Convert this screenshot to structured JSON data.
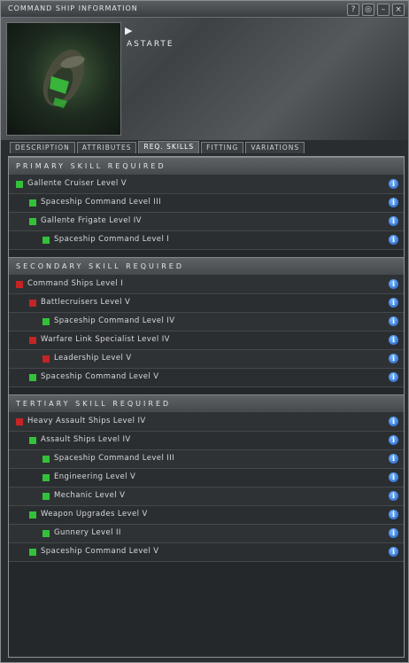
{
  "window": {
    "title": "COMMAND SHIP INFORMATION",
    "buttons": [
      "?",
      "◎",
      "–",
      "×"
    ]
  },
  "ship": {
    "name": "ASTARTE"
  },
  "tabs": [
    {
      "label": "DESCRIPTION",
      "active": false
    },
    {
      "label": "ATTRIBUTES",
      "active": false
    },
    {
      "label": "REQ. SKILLS",
      "active": true
    },
    {
      "label": "FITTING",
      "active": false
    },
    {
      "label": "VARIATIONS",
      "active": false
    }
  ],
  "sections": [
    {
      "title": "PRIMARY SKILL REQUIRED",
      "skills": [
        {
          "label": "Gallente Cruiser Level V",
          "status": "green",
          "depth": 0
        },
        {
          "label": "Spaceship Command Level III",
          "status": "green",
          "depth": 1
        },
        {
          "label": "Gallente Frigate Level IV",
          "status": "green",
          "depth": 1
        },
        {
          "label": "Spaceship Command Level I",
          "status": "green",
          "depth": 2
        }
      ]
    },
    {
      "title": "SECONDARY SKILL REQUIRED",
      "skills": [
        {
          "label": "Command Ships Level I",
          "status": "red",
          "depth": 0
        },
        {
          "label": "Battlecruisers Level V",
          "status": "red",
          "depth": 1
        },
        {
          "label": "Spaceship Command Level IV",
          "status": "green",
          "depth": 2
        },
        {
          "label": "Warfare Link Specialist Level IV",
          "status": "red",
          "depth": 1
        },
        {
          "label": "Leadership Level V",
          "status": "red",
          "depth": 2
        },
        {
          "label": "Spaceship Command Level V",
          "status": "green",
          "depth": 1
        }
      ]
    },
    {
      "title": "TERTIARY SKILL REQUIRED",
      "skills": [
        {
          "label": "Heavy Assault Ships Level IV",
          "status": "red",
          "depth": 0
        },
        {
          "label": "Assault Ships Level IV",
          "status": "green",
          "depth": 1
        },
        {
          "label": "Spaceship Command Level III",
          "status": "green",
          "depth": 2
        },
        {
          "label": "Engineering Level V",
          "status": "green",
          "depth": 2
        },
        {
          "label": "Mechanic Level V",
          "status": "green",
          "depth": 2
        },
        {
          "label": "Weapon Upgrades Level V",
          "status": "green",
          "depth": 1
        },
        {
          "label": "Gunnery Level II",
          "status": "green",
          "depth": 2
        },
        {
          "label": "Spaceship Command Level V",
          "status": "green",
          "depth": 1
        }
      ]
    }
  ],
  "info_icon": "i",
  "colors": {
    "trained": "#33c13a",
    "untrained": "#c42424",
    "info": "#1e5fc8"
  }
}
